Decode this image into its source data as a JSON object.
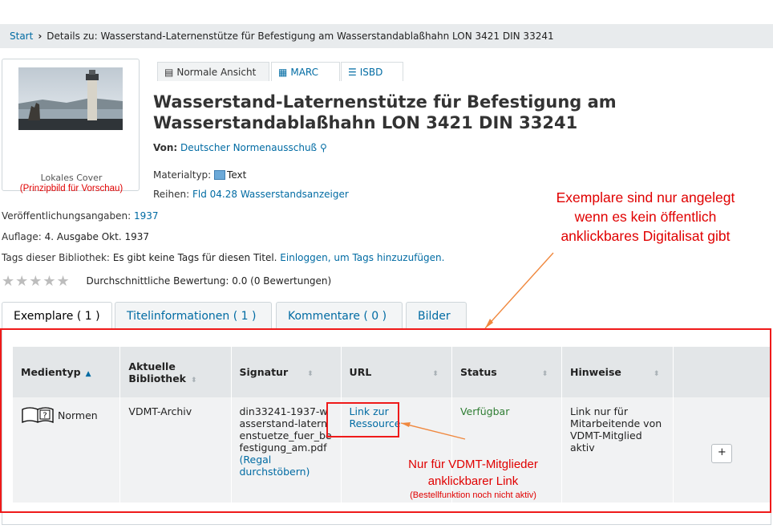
{
  "breadcrumb": {
    "start": "Start",
    "current": "Details zu: Wasserstand-Laternenstütze für Befestigung am Wasserstandablaßhahn LON 3421 DIN 33241"
  },
  "cover": {
    "label": "Lokales Cover",
    "note": "(Prinzipbild für Vorschau)"
  },
  "view_tabs": {
    "normal": "Normale Ansicht",
    "marc": "MARC",
    "isbd": "ISBD"
  },
  "record": {
    "title_line1": "Wasserstand-Laternenstütze für Befestigung am",
    "title_line2": "Wasserstandablaßhahn LON 3421 DIN 33241",
    "by_label": "Von:",
    "by_value": "Deutscher Normenausschuß",
    "mattype_label": "Materialtyp:",
    "mattype_value": "Text",
    "series_label": "Reihen:",
    "series_value": "Fld 04.28 Wasserstandsanzeiger",
    "pub_label": "Veröffentlichungsangaben:",
    "pub_value": "1937",
    "edition_label": "Auflage:",
    "edition_value": "4. Ausgabe Okt. 1937",
    "tags_label": "Tags dieser Bibliothek:",
    "tags_text": "Es gibt keine Tags für diesen Titel.",
    "tags_link": "Einloggen, um Tags hinzuzufügen.",
    "rating_text": "Durchschnittliche Bewertung: 0.0 (0 Bewertungen)",
    "rating_stars": 0
  },
  "detail_tabs": {
    "exemplare": "Exemplare ( 1 )",
    "titel": "Titelinformationen ( 1 )",
    "komm": "Kommentare ( 0 )",
    "bilder": "Bilder"
  },
  "holdings": {
    "headers": {
      "medientyp": "Medientyp",
      "bibliothek_1": "Aktuelle",
      "bibliothek_2": "Bibliothek",
      "signatur": "Signatur",
      "url": "URL",
      "status": "Status",
      "hinweise": "Hinweise"
    },
    "row": {
      "medientyp": "Normen",
      "bibliothek": "VDMT-Archiv",
      "signatur": "din33241-1937-wasserstand-laternenstuetze_fuer_befestigung_am.pdf",
      "signatur_link": "(Regal durchstöbern)",
      "url_link": "Link zur Ressource",
      "status": "Verfügbar",
      "hinweise": "Link nur für Mitarbeitende von VDMT-Mitglied aktiv",
      "add": "+"
    }
  },
  "annotations": {
    "exemplare_1": "Exemplare sind nur angelegt",
    "exemplare_2": "wenn es kein öffentlich",
    "exemplare_3": "anklickbares Digitalisat gibt",
    "link_1": "Nur für VDMT-Mitglieder",
    "link_2": "anklickbarer Link",
    "link_3": "(Bestellfunktion noch nicht aktiv)"
  },
  "colors": {
    "link": "#006ba3",
    "annotation": "#e00000",
    "available": "#2e7d32"
  }
}
